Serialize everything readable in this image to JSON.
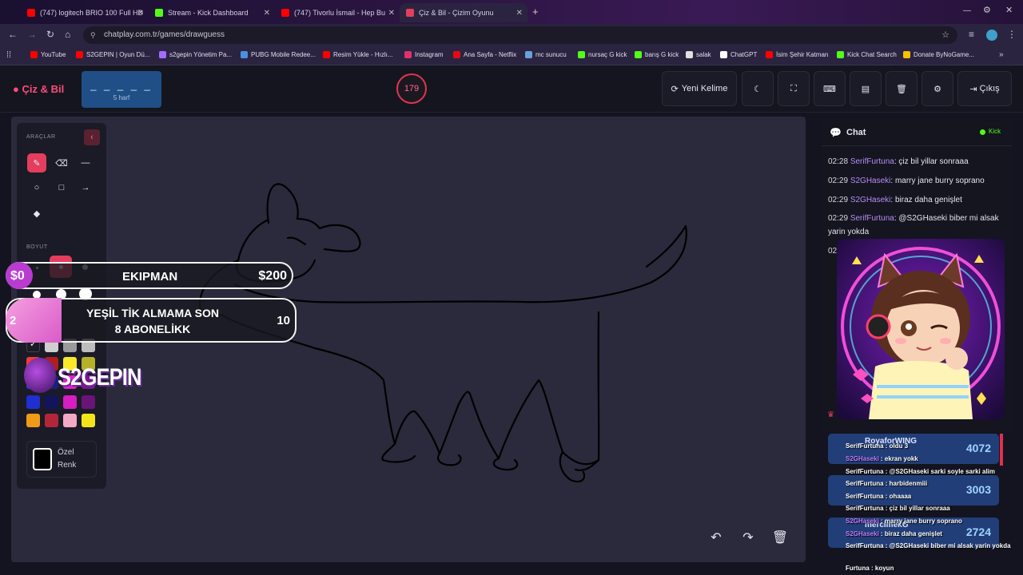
{
  "browser": {
    "tabs": [
      {
        "title": "(747) logitech BRIO 100 Full HD",
        "color": "#ff0000"
      },
      {
        "title": "Stream - Kick Dashboard",
        "color": "#53fc18"
      },
      {
        "title": "(747) Tivorlu İsmail - Hep Bu",
        "color": "#ff0000"
      },
      {
        "title": "Çiz & Bil - Çizim Oyunu",
        "color": "#e43d5d"
      }
    ],
    "url": "chatplay.com.tr/games/drawguess",
    "bookmarks": [
      {
        "label": "YouTube",
        "color": "#ff0000"
      },
      {
        "label": "S2GEPIN | Oyun Dü...",
        "color": "#ff0000"
      },
      {
        "label": "s2gepin Yönetim Pa...",
        "color": "#a36bff"
      },
      {
        "label": "PUBG Mobile Redee...",
        "color": "#4a90e2"
      },
      {
        "label": "Resim Yükle - Hızlı...",
        "color": "#ff0000"
      },
      {
        "label": "Instagram",
        "color": "#e1306c"
      },
      {
        "label": "Ana Sayfa - Netflix",
        "color": "#e50914"
      },
      {
        "label": "mc sunucu",
        "color": "#6aa0d8"
      },
      {
        "label": "nursaç G kick",
        "color": "#53fc18"
      },
      {
        "label": "barış G kick",
        "color": "#53fc18"
      },
      {
        "label": "salak",
        "color": "#e0e0e0"
      },
      {
        "label": "ChatGPT",
        "color": "#ffffff"
      },
      {
        "label": "İsim Şehir Katman",
        "color": "#ff0000"
      },
      {
        "label": "Kick Chat Search",
        "color": "#53fc18"
      },
      {
        "label": "Donate ByNoGame...",
        "color": "#f2c200"
      }
    ]
  },
  "app": {
    "logo": "Çiz & Bil",
    "word_mask": "_ _ _ _ _",
    "word_len": "5 harf",
    "timer": "179",
    "buttons": {
      "new_word": "Yeni Kelime",
      "exit": "Çıkış"
    }
  },
  "tools": {
    "title": "ARAÇLAR",
    "size_title": "BOYUT",
    "custom_color": "Özel Renk",
    "palette": [
      "#ffffff",
      "#cfcfcf",
      "#9a9a9a",
      "#bdbdbd",
      "#ef3b3b",
      "#b01e1e",
      "#f7e82a",
      "#b6b02a",
      "#2b3be0",
      "#1c1f7a",
      "#e51ecf",
      "#7a168a",
      "#f19a1a",
      "#b3263a",
      "#f2a9c4",
      "#f3e51a"
    ]
  },
  "overlay": {
    "equipment_amount_left": "$0",
    "equipment_label": "EKIPMAN",
    "equipment_amount_right": "$200",
    "goal_count": "2",
    "goal_label": "YEŞİL TİK ALMAMA SON 8 ABONELİKK",
    "goal_target": "10",
    "brand": "S2GEPIN"
  },
  "chat": {
    "title": "Chat",
    "status": "Kick",
    "messages": [
      {
        "time": "02:28",
        "user": "SerifFurtuna",
        "text": "çiz bil yillar sonraaa"
      },
      {
        "time": "02:29",
        "user": "S2GHaseki",
        "text": "marry jane burry soprano"
      },
      {
        "time": "02:29",
        "user": "S2GHaseki",
        "text": "biraz daha genişlet"
      },
      {
        "time": "02:29",
        "user": "SerifFurtuna",
        "text": "@S2GHaseki biber mi alsak yarin yokda"
      },
      {
        "time": "02",
        "user": "",
        "text": ""
      }
    ]
  },
  "leaderboard": {
    "rows": [
      {
        "name": "RoyaforWING",
        "value": "4072"
      },
      {
        "name": "",
        "value": "3003"
      },
      {
        "name": "mercimekG",
        "value": "2724"
      }
    ]
  },
  "stream_chat": [
    {
      "user": "SerifFurtuna",
      "text": "oldu 3"
    },
    {
      "user": "S2GHaseki",
      "text": "ekran yokk"
    },
    {
      "user": "SerifFurtuna",
      "text": "@S2GHaseki sarki soyle sarki alim"
    },
    {
      "user": "SerifFurtuna",
      "text": "harbidenmiii"
    },
    {
      "user": "SerifFurtuna",
      "text": "ohaaaa"
    },
    {
      "user": "SerifFurtuna",
      "text": "çiz bil yillar sonraaa"
    },
    {
      "user": "S2GHaseki",
      "text": "marry jane burry soprano"
    },
    {
      "user": "S2GHaseki",
      "text": "biraz daha genişlet"
    },
    {
      "user": "SerifFurtuna",
      "text": "@S2GHaseki biber mi alsak yarin yokda"
    },
    {
      "user": "Furtuna",
      "text": "koyun"
    }
  ]
}
